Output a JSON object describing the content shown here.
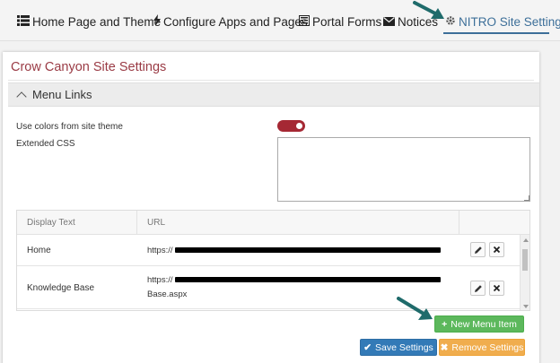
{
  "nav": {
    "items": [
      {
        "icon": "list-icon",
        "label": "Home Page and Theme"
      },
      {
        "icon": "bolt-icon",
        "label": "Configure Apps and Pages"
      },
      {
        "icon": "form-icon",
        "label": "Portal Forms"
      },
      {
        "icon": "envelope-icon",
        "label": "Notices"
      },
      {
        "icon": "gear-icon",
        "label": "NITRO Site Settings"
      }
    ],
    "active": "NITRO Site Settings"
  },
  "panel": {
    "title": "Crow Canyon Site Settings",
    "section_title": "Menu Links"
  },
  "settings": {
    "use_colors_label": "Use colors from site theme",
    "use_colors_on": true,
    "extended_css_label": "Extended CSS",
    "extended_css_value": ""
  },
  "table": {
    "headers": [
      "Display Text",
      "URL"
    ],
    "rows": [
      {
        "display": "Home",
        "url_prefix": "https://",
        "url_suffix": ""
      },
      {
        "display": "Knowledge Base",
        "url_prefix": "https://",
        "url_suffix": "Base.aspx"
      }
    ]
  },
  "buttons": {
    "new_item": "New Menu Item",
    "save": "Save Settings",
    "remove": "Remove Settings"
  },
  "colors": {
    "title": "#9a3b45",
    "toggle": "#a52834",
    "green": "#5cb85c",
    "blue": "#337ab7",
    "orange": "#f0ad4e",
    "annotation_arrow": "#1f6b6b"
  }
}
